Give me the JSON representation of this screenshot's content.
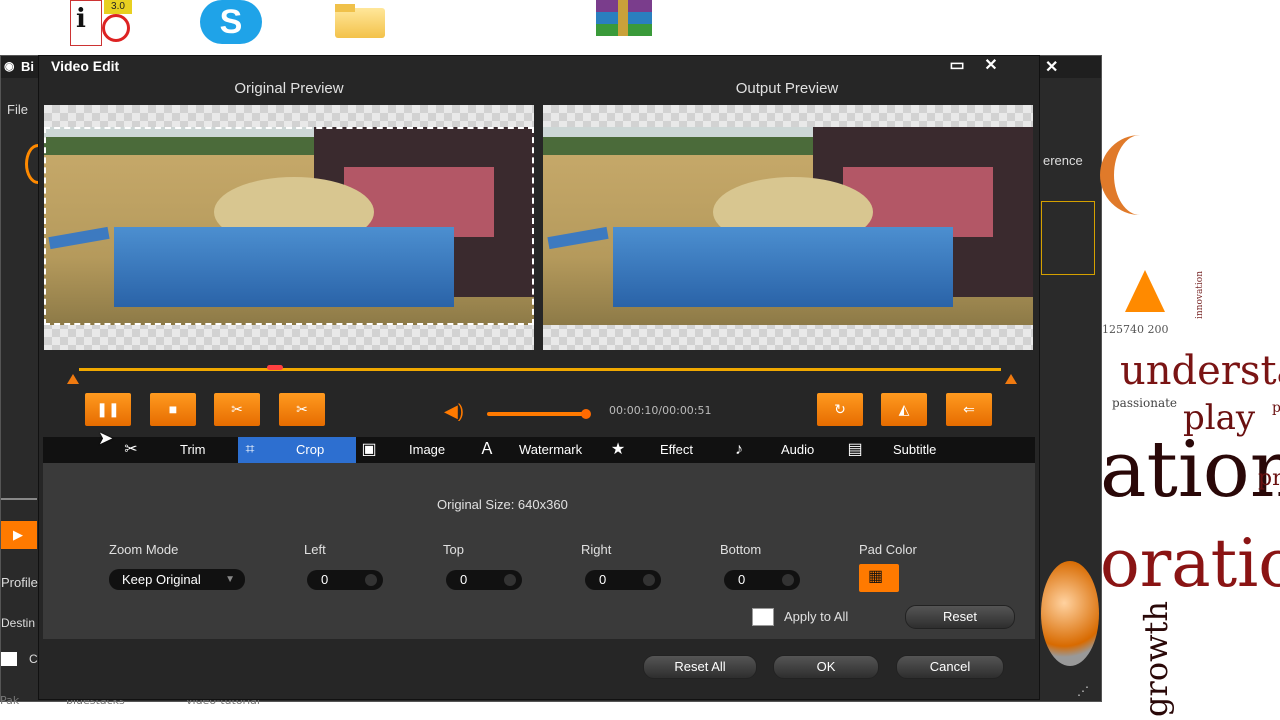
{
  "desktop": {
    "icons": [
      "info-app-icon",
      "skype-icon",
      "folder-icon",
      "winrar-icon"
    ],
    "icon_badge": "3.0",
    "taskbar_labels": [
      "Pak",
      "bluestacks",
      "video-tutorial"
    ]
  },
  "background_app": {
    "title": "Bi",
    "menu_file": "File",
    "preference_fragment": "erence",
    "profile_label": "Profile",
    "destination_label": "Destin",
    "checkbox_fragment": "C"
  },
  "word_cloud": {
    "words": [
      "understa",
      "play",
      "ation",
      "oration",
      "growth",
      "passionate",
      "pr",
      "pa",
      "innovation",
      "125740 200"
    ]
  },
  "dialog": {
    "title": "Video Edit",
    "original_preview_label": "Original Preview",
    "output_preview_label": "Output Preview",
    "time_display": "00:00:10/00:00:51",
    "colors": {
      "accent": "#ff7a00",
      "tab_active": "#2d6fd0",
      "background": "#262626"
    },
    "tabs": [
      {
        "label": "Trim",
        "icon": "scissors-icon"
      },
      {
        "label": "Crop",
        "icon": "crop-icon",
        "active": true
      },
      {
        "label": "Image",
        "icon": "image-icon"
      },
      {
        "label": "Watermark",
        "icon": "watermark-icon"
      },
      {
        "label": "Effect",
        "icon": "star-icon"
      },
      {
        "label": "Audio",
        "icon": "music-note-icon"
      },
      {
        "label": "Subtitle",
        "icon": "subtitle-icon"
      }
    ],
    "crop": {
      "original_size": "Original Size: 640x360",
      "zoom_mode_label": "Zoom Mode",
      "zoom_mode_value": "Keep Original",
      "left_label": "Left",
      "left_value": "0",
      "top_label": "Top",
      "top_value": "0",
      "right_label": "Right",
      "right_value": "0",
      "bottom_label": "Bottom",
      "bottom_value": "0",
      "pad_color_label": "Pad Color",
      "apply_to_all_label": "Apply to All",
      "reset_label": "Reset"
    },
    "footer": {
      "reset_all_label": "Reset All",
      "ok_label": "OK",
      "cancel_label": "Cancel"
    }
  }
}
